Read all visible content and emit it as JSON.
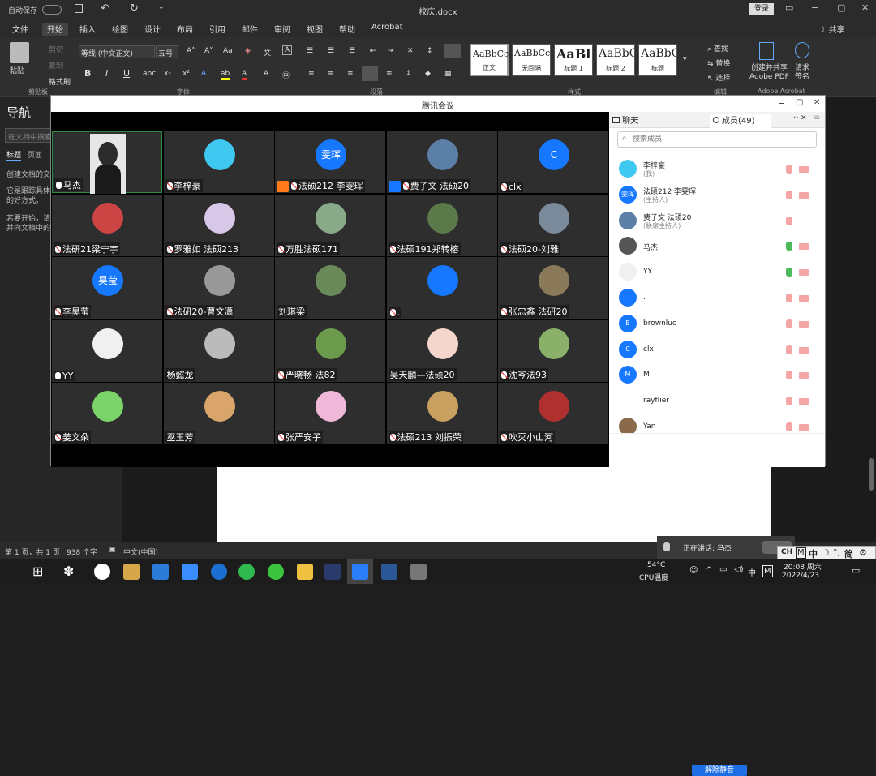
{
  "word": {
    "autosave": "自动保存",
    "doc_title": "校庆.docx",
    "login": "登录",
    "share": "共享",
    "tabs": [
      "文件",
      "开始",
      "插入",
      "绘图",
      "设计",
      "布局",
      "引用",
      "邮件",
      "审阅",
      "视图",
      "帮助",
      "Acrobat"
    ],
    "font_name": "等线 (中文正文)",
    "font_size": "五号",
    "paste": "粘贴",
    "cut": "剪切",
    "copy": "复制",
    "format_painter": "格式刷",
    "clipboard_group": "剪贴板",
    "font_group": "字体",
    "paragraph_group": "段落",
    "styles_group": "样式",
    "edit_group": "编辑",
    "adobe_group": "Adobe Acrobat",
    "styles": [
      {
        "preview": "AaBbCcDc",
        "label": "正文"
      },
      {
        "preview": "AaBbCcDc",
        "label": "无间隔"
      },
      {
        "preview": "AaBl",
        "label": "标题 1"
      },
      {
        "preview": "AaBbC",
        "label": "标题 2"
      },
      {
        "preview": "AaBbC",
        "label": "标题"
      }
    ],
    "find": "查找",
    "replace": "替换",
    "select": "选择",
    "create_pdf": "创建并共享\nAdobe PDF",
    "request_sign": "请求\n签名",
    "nav_title": "导航",
    "nav_search": "在文档中搜索",
    "nav_tabs": [
      "标题",
      "页面"
    ],
    "nav_text1": "创建文档的交",
    "nav_text2": "它是跟踪具体\n的好方式。",
    "nav_text3": "若要开始，请\n并向文档中的",
    "status_page": "第 1 页，共 1 页",
    "status_words": "938 个字",
    "status_lang": "中文(中国)"
  },
  "meeting": {
    "title": "腾讯会议",
    "chat_tab": "聊天",
    "members_tab": "成员(49)",
    "search_placeholder": "搜索成员",
    "unmute_all": "解除静音",
    "tiles": [
      {
        "name": "马杰",
        "avatar": "",
        "color": "#d9d9d9",
        "mic": "on"
      },
      {
        "name": "李梓豪",
        "avatar": "",
        "color": "#3fc8f0",
        "mic": "off"
      },
      {
        "name": "法硕212 李雯珲",
        "avatar": "雯珲",
        "color": "#1677ff",
        "mic": "off",
        "tag": "#ff7a1a"
      },
      {
        "name": "费子文 法硕20",
        "avatar": "",
        "color": "#5b7fa6",
        "mic": "off",
        "tag": "#1677ff"
      },
      {
        "name": "clx",
        "avatar": "C",
        "color": "#1677ff",
        "mic": "off"
      },
      {
        "name": "法研21梁宁宇",
        "avatar": "",
        "color": "#c44",
        "mic": "off"
      },
      {
        "name": "罗雅如 法硕213",
        "avatar": "",
        "color": "#d8c8e8",
        "mic": "off"
      },
      {
        "name": "万胜法硕171",
        "avatar": "",
        "color": "#8a8",
        "mic": "off"
      },
      {
        "name": "法硕191郑转榕",
        "avatar": "",
        "color": "#5a7a4a",
        "mic": "off"
      },
      {
        "name": "法硕20-刘雅",
        "avatar": "",
        "color": "#7a8a9a",
        "mic": "off"
      },
      {
        "name": "李昊莹",
        "avatar": "昊莹",
        "color": "#1677ff",
        "mic": "off"
      },
      {
        "name": "法研20-曹文潇",
        "avatar": "",
        "color": "#999",
        "mic": "off"
      },
      {
        "name": "刘琪梁",
        "avatar": "",
        "color": "#6a8a5a",
        "mic": "none"
      },
      {
        "name": ".",
        "avatar": "",
        "color": "#1677ff",
        "mic": "off"
      },
      {
        "name": "张忠鑫 法研20",
        "avatar": "",
        "color": "#8a7a5a",
        "mic": "off"
      },
      {
        "name": "YY",
        "avatar": "",
        "color": "#f0f0f0",
        "mic": "on"
      },
      {
        "name": "杨懿龙",
        "avatar": "",
        "color": "#bbb",
        "mic": "none"
      },
      {
        "name": "严晓畅 法82",
        "avatar": "",
        "color": "#6a9a4a",
        "mic": "off"
      },
      {
        "name": "吴天麟—法硕20",
        "avatar": "",
        "color": "#f4d6cc",
        "mic": "none"
      },
      {
        "name": "沈岑法93",
        "avatar": "",
        "color": "#8ab06a",
        "mic": "off"
      },
      {
        "name": "姜文朵",
        "avatar": "",
        "color": "#7bd46a",
        "mic": "off"
      },
      {
        "name": "巫玉芳",
        "avatar": "",
        "color": "#d9a56a",
        "mic": "none"
      },
      {
        "name": "张严安子",
        "avatar": "",
        "color": "#f0b8d8",
        "mic": "off"
      },
      {
        "name": "法硕213 刘振荣",
        "avatar": "",
        "color": "#c8a060",
        "mic": "off"
      },
      {
        "name": "吹灭小山河",
        "avatar": "",
        "color": "#b03030",
        "mic": "off"
      }
    ],
    "members": [
      {
        "name": "李梓豪",
        "role": "(我)",
        "avatar": "",
        "color": "#3fc8f0",
        "mic": "off",
        "video": true
      },
      {
        "name": "法硕212 李雯珲",
        "role": "(主持人)",
        "avatar": "雯珲",
        "color": "#1677ff",
        "mic": "off",
        "video": true
      },
      {
        "name": "费子文 法硕20",
        "role": "(联席主持人)",
        "avatar": "",
        "color": "#5b7fa6",
        "mic": "off",
        "video": false
      },
      {
        "name": "马杰",
        "role": "",
        "avatar": "",
        "color": "#555",
        "mic": "on",
        "video": true
      },
      {
        "name": "YY",
        "role": "",
        "avatar": "",
        "color": "#f0f0f0",
        "mic": "on",
        "video": true
      },
      {
        "name": ".",
        "role": "",
        "avatar": "",
        "color": "#1677ff",
        "mic": "off",
        "video": true
      },
      {
        "name": "brownluo",
        "role": "",
        "avatar": "B",
        "color": "#1677ff",
        "mic": "off",
        "video": true
      },
      {
        "name": "clx",
        "role": "",
        "avatar": "C",
        "color": "#1677ff",
        "mic": "off",
        "video": true
      },
      {
        "name": "M",
        "role": "",
        "avatar": "M",
        "color": "#1677ff",
        "mic": "off",
        "video": true
      },
      {
        "name": "rayflier",
        "role": "",
        "avatar": "",
        "color": "#fff",
        "mic": "off",
        "video": true
      },
      {
        "name": "Yan",
        "role": "",
        "avatar": "",
        "color": "#8a6a4a",
        "mic": "off",
        "video": true
      }
    ],
    "speaking": "正在讲话: 马杰"
  },
  "taskbar": {
    "temp": "54°C",
    "temp_label": "CPU温度",
    "ime1": "中",
    "ime2": "M",
    "ime_tray": "CH",
    "ime_mode": "中",
    "ime_simp": "简",
    "time": "20:08 周六",
    "date": "2022/4/23"
  }
}
